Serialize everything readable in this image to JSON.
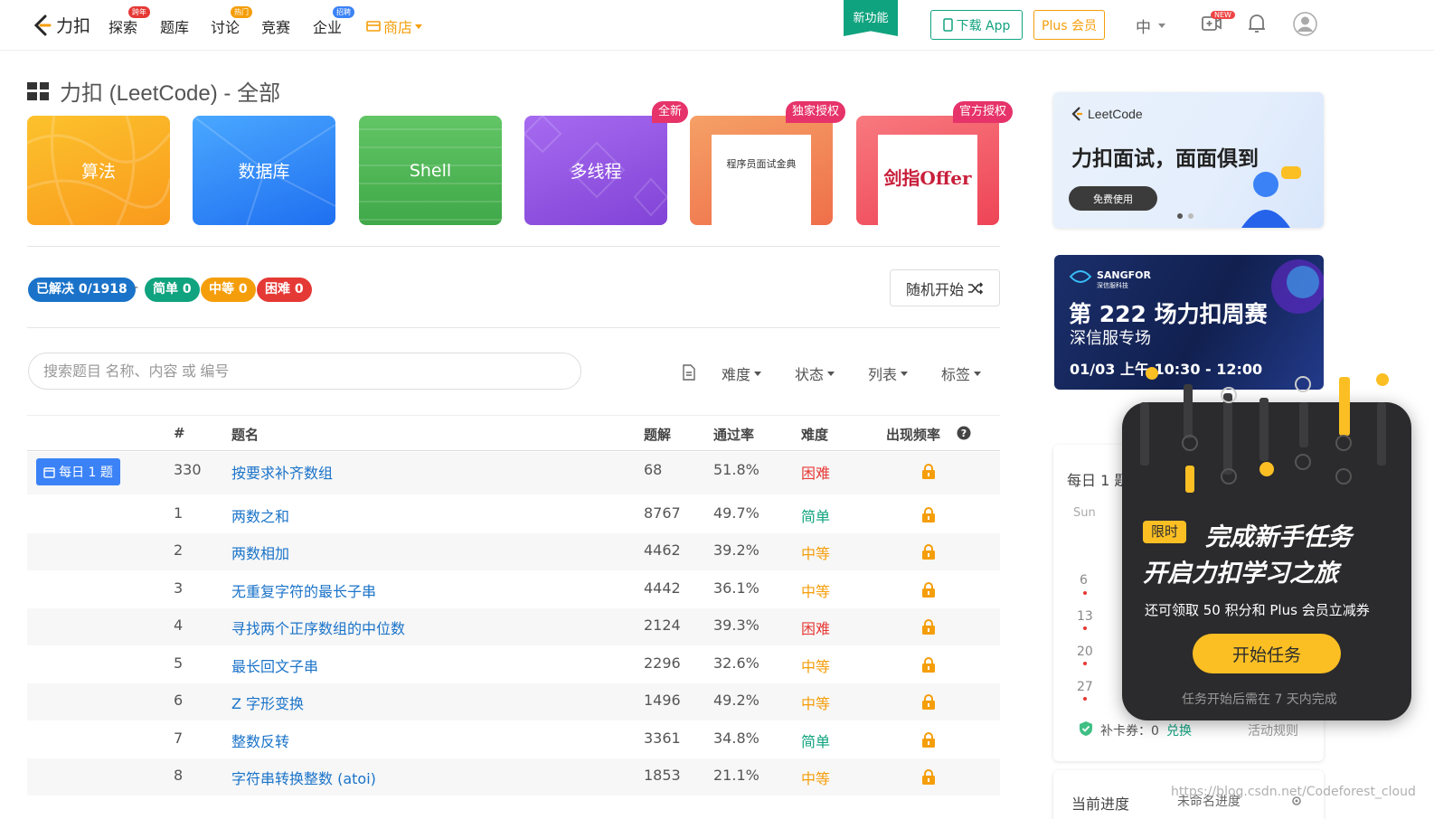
{
  "nav": {
    "logo": "力扣",
    "items": [
      {
        "label": "探索",
        "badge": "跨年"
      },
      {
        "label": "题库",
        "badge": ""
      },
      {
        "label": "讨论",
        "badge": "热门"
      },
      {
        "label": "竞赛",
        "badge": ""
      },
      {
        "label": "企业",
        "badge": "招聘"
      }
    ],
    "shop": "商店",
    "new_feature": "新功能",
    "download_app": "下载 App",
    "plus": "Plus 会员",
    "lang": "中",
    "new_badge": "NEW"
  },
  "page_title": "力扣 (LeetCode) - 全部",
  "categories": [
    {
      "label": "算法",
      "tag": ""
    },
    {
      "label": "数据库",
      "tag": ""
    },
    {
      "label": "Shell",
      "tag": ""
    },
    {
      "label": "多线程",
      "tag": "全新"
    },
    {
      "label": "程序员面试金典",
      "tag": "独家授权"
    },
    {
      "label": "剑指Offer",
      "tag": "官方授权"
    }
  ],
  "stats": {
    "solved": "已解决 0/1918",
    "separator": "-",
    "easy": "简单 0",
    "medium": "中等 0",
    "hard": "困难 0"
  },
  "random_button": "随机开始",
  "search": {
    "placeholder": "搜索题目 名称、内容 或 编号"
  },
  "filters": [
    "难度",
    "状态",
    "列表",
    "标签"
  ],
  "table": {
    "headers": {
      "num": "#",
      "title": "题名",
      "solutions": "题解",
      "rate": "通过率",
      "difficulty": "难度",
      "frequency": "出现频率"
    },
    "daily_label": "每日 1 题",
    "rows": [
      {
        "num": "330",
        "title": "按要求补齐数组",
        "solutions": "68",
        "rate": "51.8%",
        "difficulty": "困难"
      },
      {
        "num": "1",
        "title": "两数之和",
        "solutions": "8767",
        "rate": "49.7%",
        "difficulty": "简单"
      },
      {
        "num": "2",
        "title": "两数相加",
        "solutions": "4462",
        "rate": "39.2%",
        "difficulty": "中等"
      },
      {
        "num": "3",
        "title": "无重复字符的最长子串",
        "solutions": "4442",
        "rate": "36.1%",
        "difficulty": "中等"
      },
      {
        "num": "4",
        "title": "寻找两个正序数组的中位数",
        "solutions": "2124",
        "rate": "39.3%",
        "difficulty": "困难"
      },
      {
        "num": "5",
        "title": "最长回文子串",
        "solutions": "2296",
        "rate": "32.6%",
        "difficulty": "中等"
      },
      {
        "num": "6",
        "title": "Z 字形变换",
        "solutions": "1496",
        "rate": "49.2%",
        "difficulty": "中等"
      },
      {
        "num": "7",
        "title": "整数反转",
        "solutions": "3361",
        "rate": "34.8%",
        "difficulty": "简单"
      },
      {
        "num": "8",
        "title": "字符串转换整数 (atoi)",
        "solutions": "1853",
        "rate": "21.1%",
        "difficulty": "中等"
      }
    ]
  },
  "sidebar": {
    "banner1": {
      "brand": "LeetCode",
      "headline": "力扣面试，面面俱到",
      "button": "免费使用"
    },
    "banner2": {
      "brand": "SANGFOR",
      "brand_cn": "深信服科技",
      "title": "第 222 场力扣周赛",
      "subtitle": "深信服专场",
      "time": "01/03 上午 10:30 - 12:00"
    },
    "daily": {
      "title": "每日 1 题",
      "weekday": "Sun",
      "dates": [
        "6",
        "13",
        "20",
        "27"
      ],
      "makeup": "补卡券：0",
      "redeem": "兑换",
      "rules": "活动规则"
    },
    "progress": {
      "title": "当前进度",
      "name": "未命名进度"
    }
  },
  "popup": {
    "tag": "限时",
    "line1": "完成新手任务",
    "line2": "开启力扣学习之旅",
    "desc": "还可领取 50 积分和 Plus 会员立减券",
    "button": "开始任务",
    "note": "任务开始后需在 7 天内完成"
  },
  "watermark": "https://blog.csdn.net/Codeforest_cloud",
  "colors": {
    "accent": "#10a37f",
    "plus": "#f59e0b",
    "easy": "#10a37f",
    "medium": "#f59e0b",
    "hard": "#e53935",
    "link": "#1a73c9",
    "daily": "#3b82f6",
    "popup_button": "#fbbf24"
  }
}
